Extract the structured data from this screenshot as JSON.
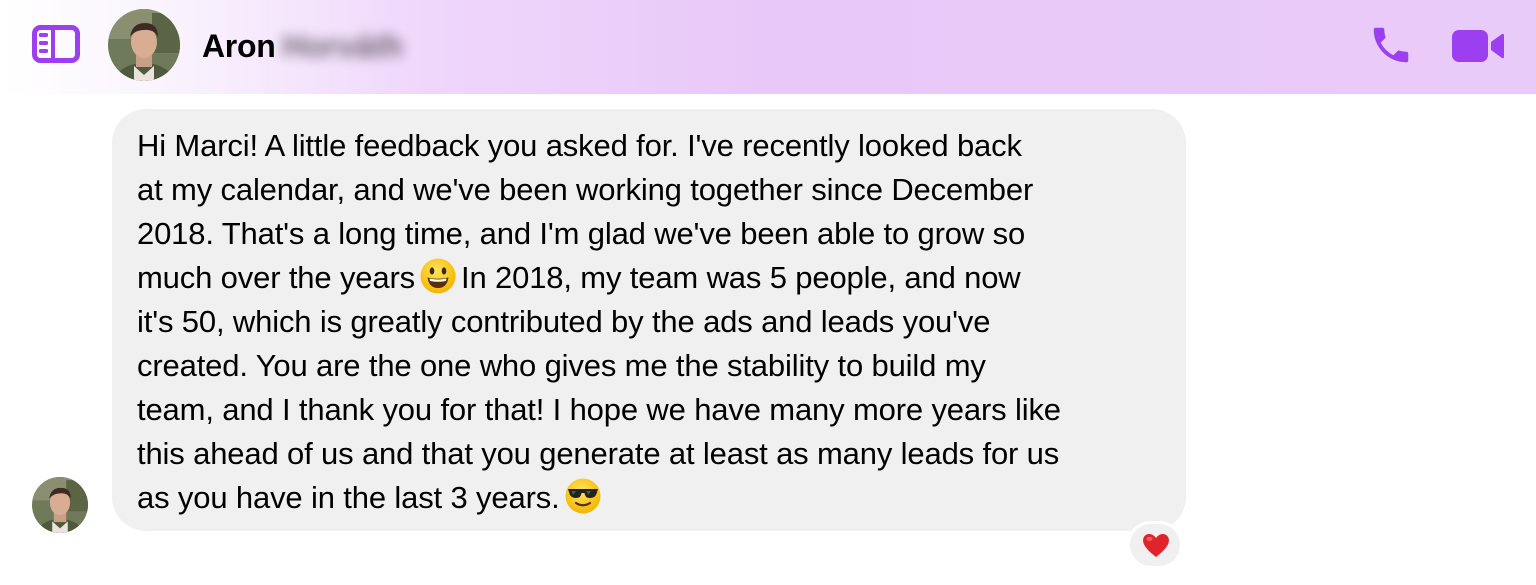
{
  "header": {
    "contact_first_name": "Aron",
    "contact_last_name_blurred": "Horváth",
    "sidebar_icon": "sidebar-toggle-icon",
    "call_icon": "phone-icon",
    "video_icon": "video-camera-icon",
    "accent_color": "#9b3ff0"
  },
  "message": {
    "lines": [
      "Hi Marci! A little feedback you asked for. I've recently looked back",
      "at my calendar, and we've been working together since December",
      "2018. That's a long time, and I'm glad we've been able to grow so"
    ],
    "line4_before_emoji": "much over the years",
    "line4_after_emoji": "In 2018, my team was 5 people, and now",
    "lines_after": [
      "it's 50, which is greatly contributed by the ads and leads you've",
      "created. You are the one who gives me the stability to build my",
      "team, and I thank you for that! I hope we have many more years like",
      "this ahead of us and that you generate at least as many leads for us"
    ],
    "last_line": "as you have in the last 3 years.",
    "emoji_1": "smiling-face-icon",
    "emoji_2": "sunglasses-face-icon",
    "bubble_color": "#f0f0f0"
  },
  "reaction": {
    "icon": "red-heart-icon",
    "color": "#e0242b"
  }
}
